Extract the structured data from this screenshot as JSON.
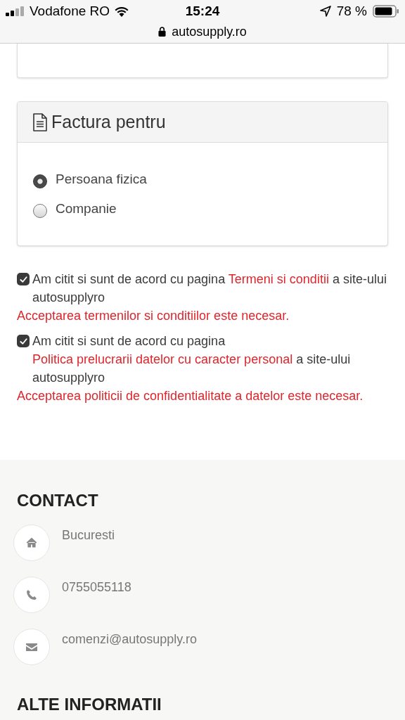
{
  "status_bar": {
    "carrier": "Vodafone RO",
    "time": "15:24",
    "battery": "78 %",
    "url": "autosupply.ro"
  },
  "invoice_card": {
    "title": "Factura pentru",
    "options": [
      {
        "label": "Persoana fizica",
        "selected": true
      },
      {
        "label": "Companie",
        "selected": false
      }
    ]
  },
  "agreements": [
    {
      "checked": true,
      "text_before": "Am citit si sunt de acord cu pagina",
      "link": "Termeni si conditii",
      "text_after": "a site-ului autosupplyro",
      "error": "Acceptarea termenilor si conditiilor este necesar."
    },
    {
      "checked": true,
      "text_before": "Am citit si sunt de acord cu pagina",
      "link": "Politica prelucrarii datelor cu caracter personal",
      "text_after": "a site-ului autosupplyro",
      "error": "Acceptarea politicii de confidentialitate a datelor este necesar."
    }
  ],
  "footer": {
    "contact_title": "CONTACT",
    "contacts": [
      {
        "kind": "address",
        "text": "Bucuresti"
      },
      {
        "kind": "phone",
        "text": "0755055118"
      },
      {
        "kind": "email",
        "text": "comenzi@autosupply.ro"
      }
    ],
    "next_title": "ALTE INFORMATII"
  }
}
